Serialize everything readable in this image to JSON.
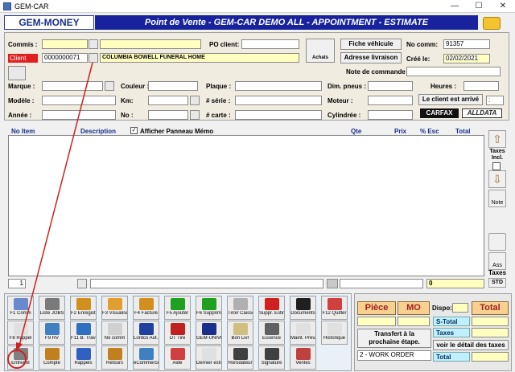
{
  "window": {
    "title": "GEM-CAR",
    "min": "—",
    "max": "☐",
    "close": "✕"
  },
  "logo": "GEM-MONEY",
  "banner": "Point de Vente - GEM-CAR DEMO ALL  - APPOINTMENT - ESTIMATE",
  "header": {
    "commis_label": "Commis :",
    "client_label": "Client",
    "client_number": "0000000071",
    "client_name": "COLUMBIA BOWELL FUNERAL HOME",
    "po_label": "PO client:",
    "achats_label": "Achats",
    "fiche_vehicule": "Fiche véhicule",
    "adresse_livraison": "Adresse livraison",
    "no_comm_label": "No comm:",
    "no_comm_value": "91357",
    "cree_le_label": "Créé le:",
    "cree_le_value": "02/02/2021",
    "note_commande_label": "Note de commande"
  },
  "vehicle": {
    "marque": "Marque :",
    "couleur": "Couleur :",
    "plaque": "Plaque :",
    "dim_pneus": "Dim. pneus :",
    "heures": "Heures :",
    "modele": "Modèle :",
    "km": "Km:",
    "serie": "# série :",
    "moteur": "Moteur :",
    "client_arrive": "Le client est arrivé",
    "client_arrive_field": ":",
    "annee": "Année :",
    "no": "No :",
    "carte": "# carte :",
    "cylindree": "Cylindrée :",
    "carfax": "CARFAX",
    "alldata": "ALLDATA"
  },
  "grid": {
    "columns": [
      "No Item",
      "Description",
      "Afficher Panneau Mémo",
      "Qte",
      "Prix",
      "% Esc",
      "Total"
    ],
    "memo_checked": "✓",
    "row_number": "1",
    "footer_value": "0"
  },
  "sidebar": {
    "taxes_incl": "Taxes Incl.",
    "note": "Note",
    "ass": "Ass",
    "taxes": "Taxes",
    "std": "STD"
  },
  "tiles": [
    {
      "label": "F1 Comm",
      "color": "#6a8ad0"
    },
    {
      "label": "Liste JOBS",
      "color": "#7a7a7a"
    },
    {
      "label": "F2 Enregistrer",
      "color": "#d09020"
    },
    {
      "label": "F3 Visualiser",
      "color": "#e0a030"
    },
    {
      "label": "F4 Facture",
      "color": "#d09020"
    },
    {
      "label": "F5 Ajouter",
      "color": "#20a020"
    },
    {
      "label": "F6 Supprimer",
      "color": "#20a020"
    },
    {
      "label": "Tiroir Caisse",
      "color": "#b0b0b0"
    },
    {
      "label": "Suppr. Estime",
      "color": "#d02020"
    },
    {
      "label": "Documents",
      "color": "#202020"
    },
    {
      "label": "F12 Quitter",
      "color": "#d04040"
    },
    {
      "label": "F8 Rappel",
      "color": "#e0e0e0"
    },
    {
      "label": "F9 RV",
      "color": "#4080c0"
    },
    {
      "label": "F11 B. Travail",
      "color": "#3070c0"
    },
    {
      "label": "No comm",
      "color": "#d0d0d0"
    },
    {
      "label": "Lordco Aut...",
      "color": "#2040a0"
    },
    {
      "label": "DT Tire",
      "color": "#c02020"
    },
    {
      "label": "GEM-UNIVER...",
      "color": "#1a2f8c"
    },
    {
      "label": "Bon Livr",
      "color": "#d0c080"
    },
    {
      "label": "Essence",
      "color": "#606060"
    },
    {
      "label": "Maint. Prév.",
      "color": "#e0e0e0"
    },
    {
      "label": "Historique",
      "color": "#e0e0e0"
    },
    {
      "label": "Entrepôt",
      "color": "#808080"
    },
    {
      "label": "Compte",
      "color": "#c08020"
    },
    {
      "label": "Rappels",
      "color": "#3060c0"
    },
    {
      "label": "Retours",
      "color": "#c08020"
    },
    {
      "label": "eCommerce",
      "color": "#4080c0"
    },
    {
      "label": "Aide",
      "color": "#d04040"
    },
    {
      "label": "Dernier estimé",
      "color": "#e0e0e0"
    },
    {
      "label": "Horodateur",
      "color": "#404040"
    },
    {
      "label": "Signature",
      "color": "#404040"
    },
    {
      "label": "Ventes",
      "color": "#c04040"
    }
  ],
  "totals": {
    "piece": "Pièce",
    "mo": "MO",
    "dispo": "Dispo:",
    "total": "Total",
    "s_total": "S-Total",
    "transfert": "Transfert à la prochaine étape.",
    "taxes": "Taxes",
    "voir_detail": "voir le détail des taxes",
    "stage_select": "2 - WORK ORDER",
    "total2": "Total"
  },
  "colors": {
    "banner": "#17229c",
    "accent_red": "#e02020",
    "highlight_yellow": "#ffffc0"
  }
}
